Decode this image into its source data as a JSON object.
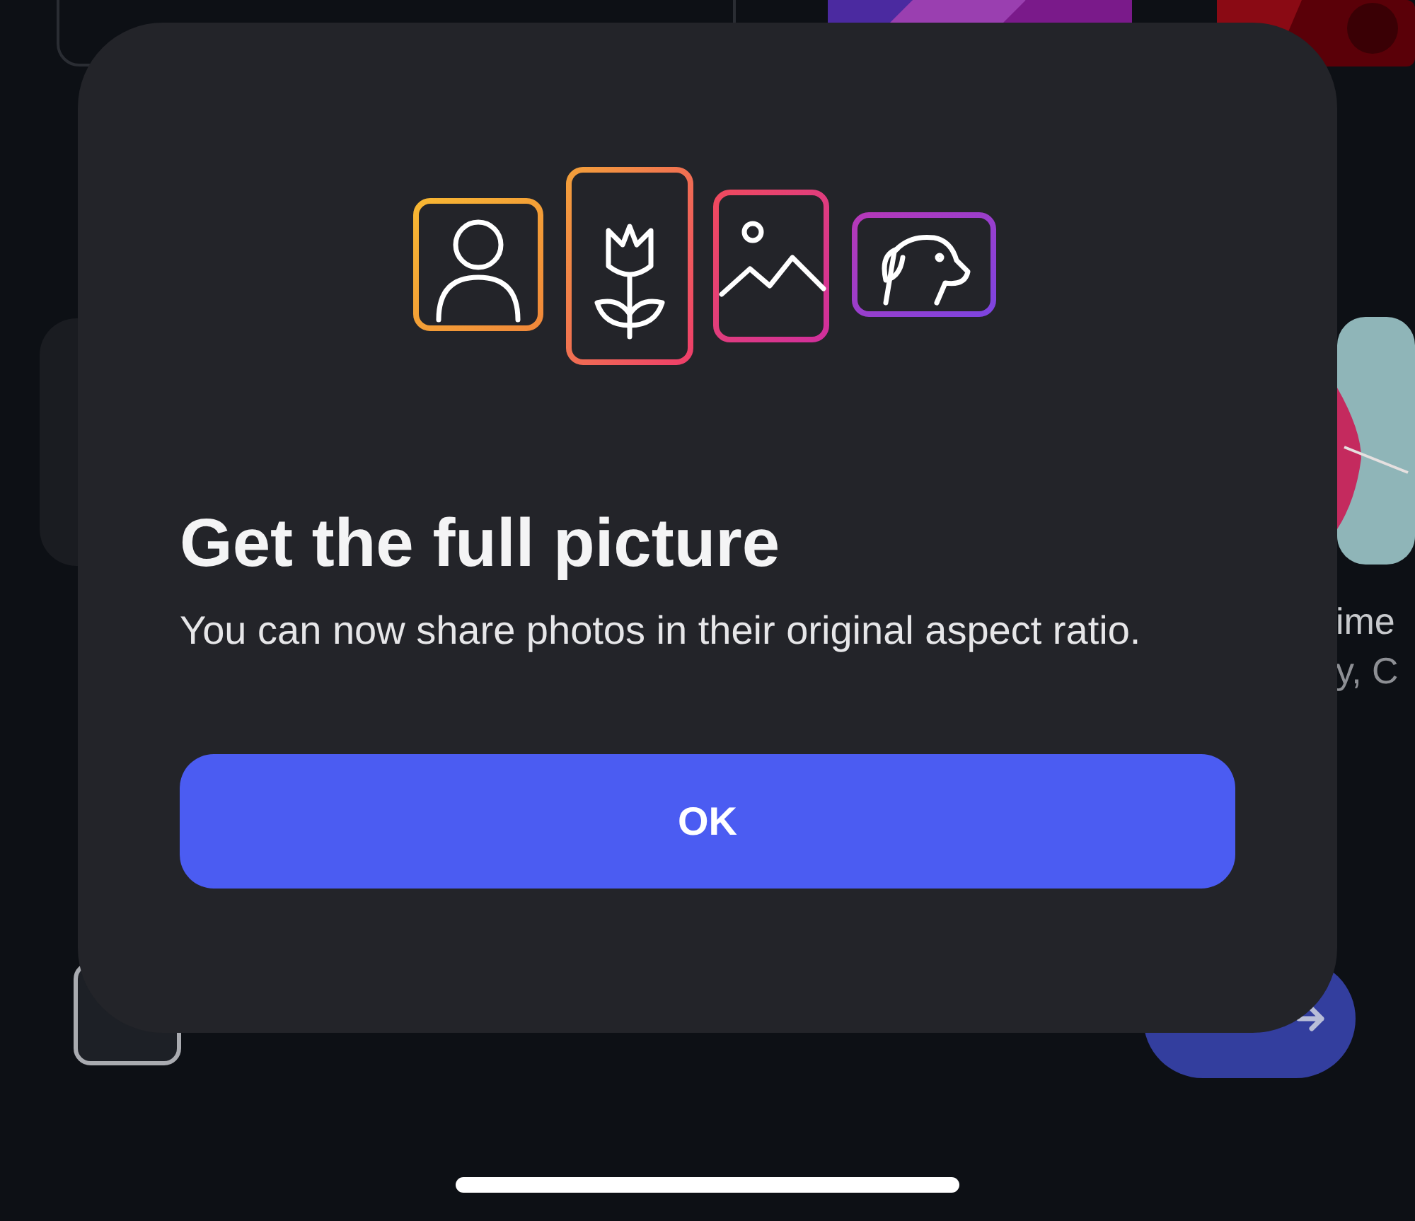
{
  "background": {
    "side_texts": [
      "ime",
      "y, C"
    ]
  },
  "dialog": {
    "title": "Get the full picture",
    "message": "You can now share photos in their original aspect ratio.",
    "button": "OK"
  }
}
